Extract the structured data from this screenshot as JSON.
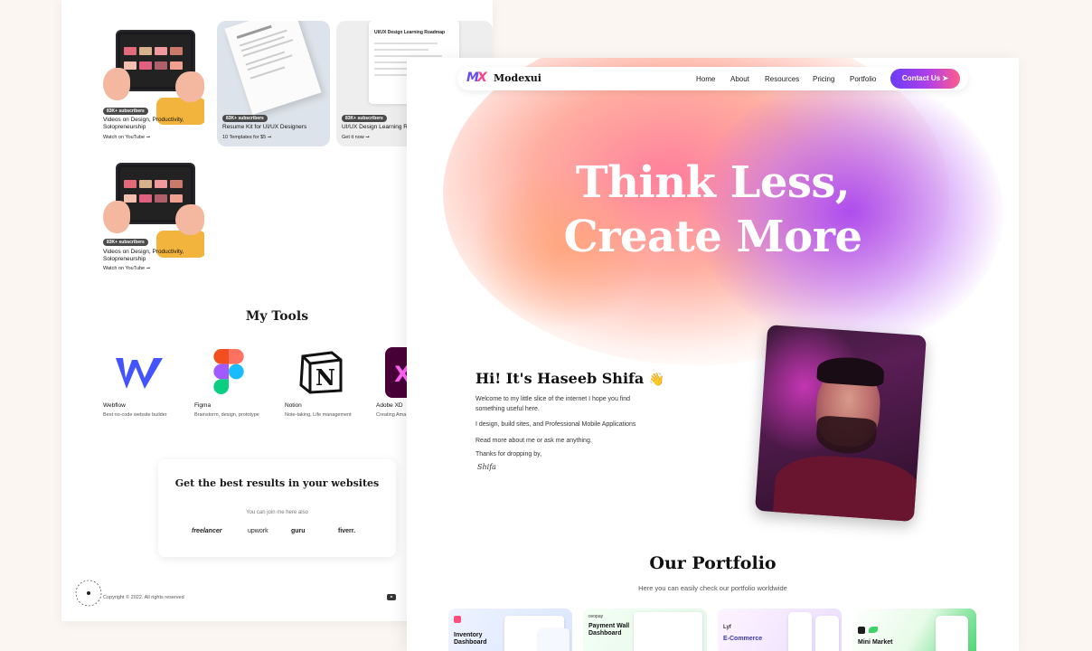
{
  "back_page": {
    "cards": [
      {
        "badge": "83K+ subscribers",
        "title": "Videos on Design, Productivity, Solopreneurship",
        "link": "Watch on YouTube"
      },
      {
        "badge": "83K+ subscribers",
        "title": "Resume Kit for UI/UX Designers",
        "link": "10 Templates for $5"
      },
      {
        "badge": "83K+ subscribers",
        "title": "UI/UX Design Learning Ro",
        "link": "Get it now",
        "doc_heading": "UI/UX Design Learning Roadmap"
      },
      {
        "badge": "83K+ subscribers",
        "title": "Videos on Design, Productivity, Solopreneurship",
        "link": "Watch on YouTube"
      }
    ],
    "tools_title": "My Tools",
    "tools": [
      {
        "name": "Webflow",
        "desc": "Best no-code website builder",
        "icon": "webflow-icon"
      },
      {
        "name": "Figma",
        "desc": "Brainstorm, design, prototype",
        "icon": "figma-icon"
      },
      {
        "name": "Notion",
        "desc": "Note-taking, Life management",
        "icon": "notion-icon"
      },
      {
        "name": "Adobe XD",
        "desc": "Creating Ama",
        "icon": "adobe-xd-icon"
      }
    ],
    "results": {
      "title": "Get the best results in your websites",
      "subtitle": "You can join me here also",
      "platforms": [
        "freelancer",
        "upwork",
        "guru",
        "fiverr."
      ]
    },
    "copyright": "Copyright © 2022. All rights reserved"
  },
  "front_page": {
    "brand": {
      "mark_m": "M",
      "mark_x": "X",
      "name": "Modexui"
    },
    "nav": [
      "Home",
      "About",
      "Resources",
      "Pricing",
      "Portfolio"
    ],
    "contact": "Contact Us",
    "hero_line1": "Think Less,",
    "hero_line2": "Create More",
    "intro": {
      "title": "Hi! It's Haseeb Shifa",
      "p1": "Welcome to my little slice of the internet   I hope you find something useful here.",
      "p2": "I design, build sites, and Professional Mobile Applications",
      "p3": "Read more about me or ask me anything.",
      "p4": "Thanks for dropping by,",
      "signature": "Shifa"
    },
    "portfolio_title": "Our Portfolio",
    "portfolio_sub": "Here you can easily check our portfolio worldwide",
    "portfolio_cards": [
      {
        "label": "Inventory Dashboard",
        "brand": ""
      },
      {
        "label": "Payment Wall Dashboard",
        "brand": "ovopay"
      },
      {
        "label": "E-Commerce",
        "brand": "Lyf"
      },
      {
        "label": "Mini Market",
        "brand": ""
      }
    ]
  },
  "colors": {
    "accent_purple": "#6b3cf5",
    "accent_pink": "#ff5c8a",
    "hero_purple": "#aa46f0",
    "hero_coral": "#ff7896"
  }
}
